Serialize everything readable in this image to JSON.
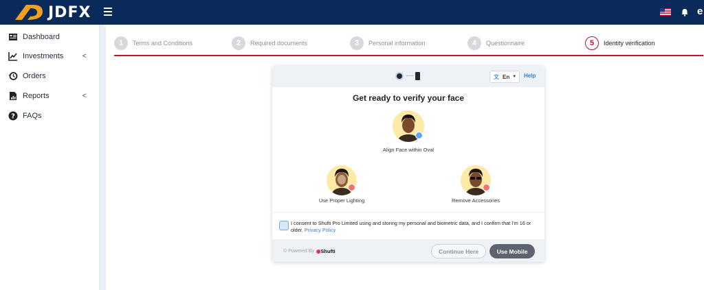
{
  "brand": {
    "name": "JDFX",
    "accent": "#f0a020",
    "bar_color": "#0a2a5a"
  },
  "topbar": {
    "user_initial": "e",
    "icons": [
      "menu-icon",
      "us-flag-icon",
      "bell-icon"
    ]
  },
  "sidebar": {
    "items": [
      {
        "label": "Dashboard",
        "icon": "dashboard-icon",
        "has_chevron": false
      },
      {
        "label": "Investments",
        "icon": "chart-up-icon",
        "has_chevron": true
      },
      {
        "label": "Orders",
        "icon": "history-icon",
        "has_chevron": false
      },
      {
        "label": "Reports",
        "icon": "report-icon",
        "has_chevron": true
      },
      {
        "label": "FAQs",
        "icon": "question-icon",
        "has_chevron": false
      }
    ],
    "chevron": "<"
  },
  "stepper": {
    "steps": [
      {
        "num": "1",
        "label": "Terms and Conditions"
      },
      {
        "num": "2",
        "label": "Required documents"
      },
      {
        "num": "3",
        "label": "Personal information"
      },
      {
        "num": "4",
        "label": "Questionnaire"
      },
      {
        "num": "5",
        "label": "Identity verification"
      }
    ],
    "active_step": "5",
    "accent": "#c8102e"
  },
  "verify": {
    "lang": "En",
    "help": "Help",
    "title": "Get ready to verify your face",
    "tips": [
      {
        "caption": "Align Face within Oval",
        "status": "ok"
      },
      {
        "caption": "Use Proper Lighting",
        "status": "no"
      },
      {
        "caption": "Remove Accessories",
        "status": "no"
      }
    ],
    "consent": {
      "text": "I consent to Shufti Pro Limited using and storing my personal and biometric data, and I confirm that I'm 16 or older.",
      "link": "Privacy Policy"
    },
    "footer": {
      "powered_by": "Powered By",
      "brand": "Shufti",
      "continue_label": "Continue Here",
      "mobile_label": "Use Mobile"
    }
  }
}
